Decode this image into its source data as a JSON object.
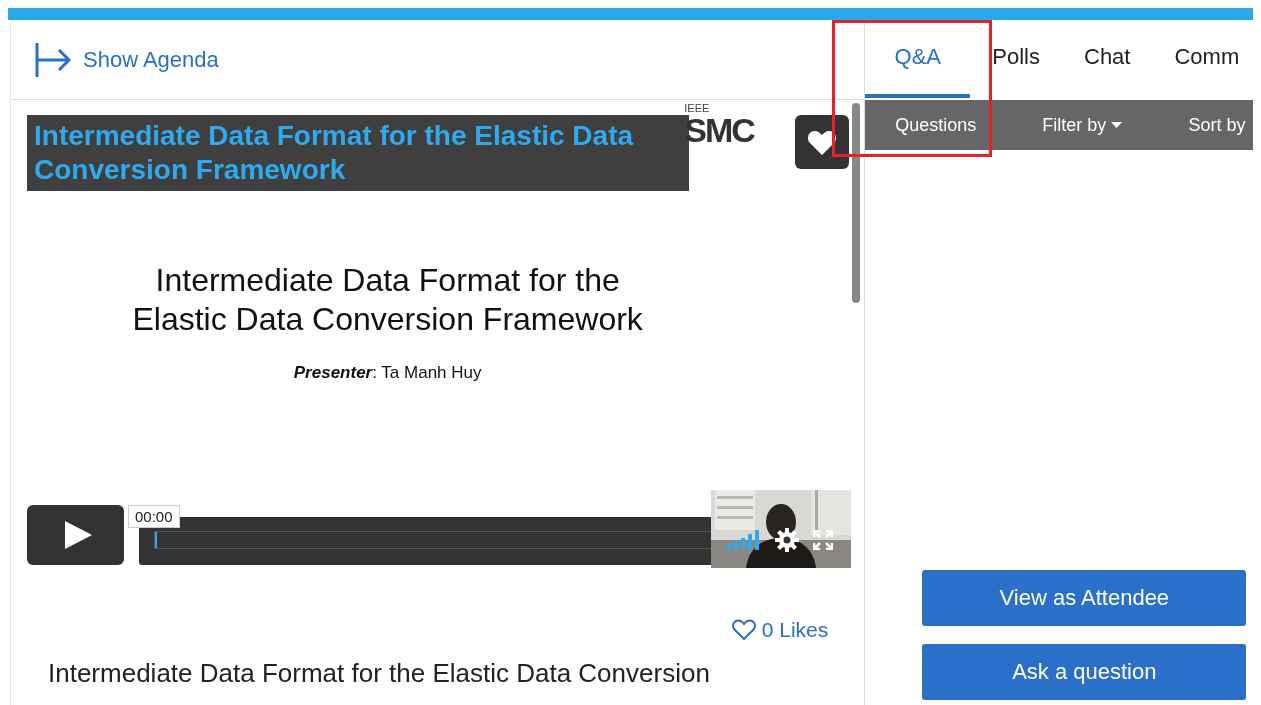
{
  "agenda_link": "Show Agenda",
  "video": {
    "title": "Intermediate Data Format for the Elastic Data Conversion Framework",
    "slide": {
      "org": "IEEE",
      "logo": "SMC",
      "title_lines": [
        "Intermediate Data Format for the",
        "Elastic Data Conversion Framework"
      ],
      "presenter": "**Presenter**: Ta Manh Huy"
    },
    "time": "00:00",
    "progress": {
      "level": 0
    }
  },
  "likes": "0 Likes",
  "session_title": "Intermediate Data Format for the Elastic Data Conversion",
  "tabs": [
    {
      "label": "Q&A",
      "selected": true
    },
    {
      "label": "Polls",
      "selected": false
    },
    {
      "label": "Chat",
      "selected": false
    },
    {
      "label": "Comm",
      "selected": false
    }
  ],
  "subbar": [
    {
      "label": "Questions",
      "kind": "text"
    },
    {
      "label": "Filter by",
      "kind": "dropdown"
    },
    {
      "label": "Sort by",
      "kind": "text"
    }
  ],
  "buttons": [
    "View as Attendee",
    "Ask a question"
  ]
}
